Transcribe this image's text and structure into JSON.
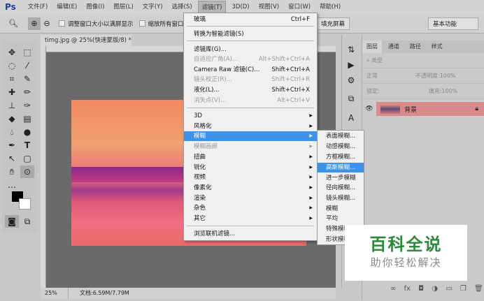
{
  "menubar": {
    "logo": "Ps",
    "items": [
      "文件(F)",
      "编辑(E)",
      "图像(I)",
      "图层(L)",
      "文字(Y)",
      "选择(S)",
      "滤镜(T)",
      "3D(D)",
      "视图(V)",
      "窗口(W)",
      "帮助(H)"
    ]
  },
  "options": {
    "resize_windows": "调整窗口大小以满屏显示",
    "zoom_all": "缩放所有窗口",
    "fill_screen": "填充屏幕",
    "workspace": "基本功能"
  },
  "document": {
    "tab": "timg.jpg @ 25%(快速蒙版/8) *",
    "zoom": "25%",
    "doc_size": "文档:6.59M/7.79M"
  },
  "filter_menu": {
    "last": {
      "label": "玻璃",
      "shortcut": "Ctrl+F"
    },
    "smart": "转换为智能滤镜(S)",
    "gallery": {
      "label": "滤镜库(G)..."
    },
    "adaptive": {
      "label": "自适应广角(A)...",
      "shortcut": "Alt+Shift+Ctrl+A"
    },
    "camera": {
      "label": "Camera Raw 滤镜(C)...",
      "shortcut": "Shift+Ctrl+A"
    },
    "lens": {
      "label": "镜头校正(R)...",
      "shortcut": "Shift+Ctrl+R"
    },
    "liquify": {
      "label": "液化(L)...",
      "shortcut": "Shift+Ctrl+X"
    },
    "vanish": {
      "label": "消失点(V)...",
      "shortcut": "Alt+Ctrl+V"
    },
    "groups": [
      "3D",
      "风格化",
      "模糊",
      "模糊画廊",
      "扭曲",
      "锐化",
      "视频",
      "像素化",
      "渲染",
      "杂色",
      "其它"
    ],
    "browse": "浏览联机滤镜..."
  },
  "blur_submenu": [
    "表面模糊...",
    "动感模糊...",
    "方框模糊...",
    "高斯模糊...",
    "进一步模糊",
    "径向模糊...",
    "镜头模糊...",
    "模糊",
    "平均",
    "特殊模糊...",
    "形状模糊..."
  ],
  "layers_panel": {
    "tabs": [
      "图层",
      "通道",
      "路径",
      "样式"
    ],
    "filter": "类型",
    "blend": "正常",
    "opacity_label": "不透明度:",
    "opacity": "100%",
    "lock_label": "锁定:",
    "fill_label": "填充:",
    "fill": "100%",
    "layer_name": "背景"
  },
  "watermark": {
    "title": "百科全说",
    "subtitle": "助你轻松解决"
  }
}
